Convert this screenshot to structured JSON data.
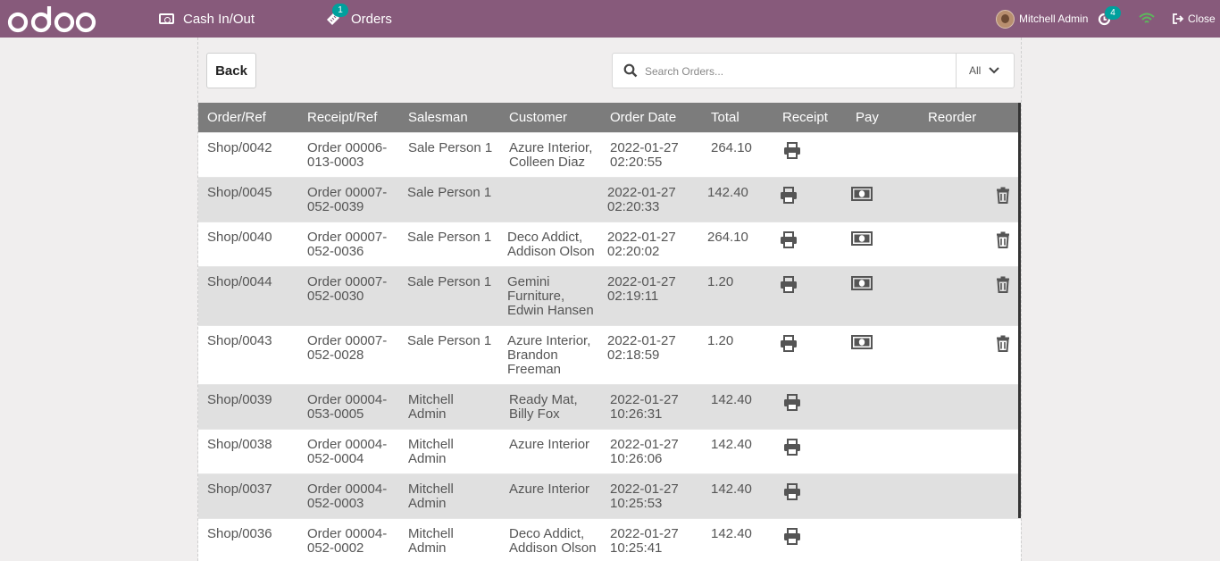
{
  "topbar": {
    "logo_text": "odoo",
    "cash_label": "Cash In/Out",
    "orders_label": "Orders",
    "orders_badge": "1",
    "user_name": "Mitchell Admin",
    "sync_badge": "4",
    "close_label": "Close",
    "colors": {
      "bar": "#875a7b",
      "badge": "#00a09d",
      "wifi": "#5cb85c"
    }
  },
  "toolbar": {
    "back_label": "Back",
    "search_placeholder": "Search Orders...",
    "filter_label": "All"
  },
  "table": {
    "columns": [
      "Order/Ref",
      "Receipt/Ref",
      "Salesman",
      "Customer",
      "Order Date",
      "Total",
      "Receipt",
      "Pay",
      "Reorder"
    ],
    "rows": [
      {
        "order": "Shop/0042",
        "receipt": [
          "Order 00006-",
          "013-0003"
        ],
        "salesman": [
          "Sale Person 1"
        ],
        "customer": [
          "Azure Interior,",
          "Colleen Diaz"
        ],
        "date": [
          "2022-01-27",
          "02:20:55"
        ],
        "total": "264.10",
        "pay": false,
        "reorder": false
      },
      {
        "order": "Shop/0045",
        "receipt": [
          "Order 00007-",
          "052-0039"
        ],
        "salesman": [
          "Sale Person 1"
        ],
        "customer": [],
        "date": [
          "2022-01-27",
          "02:20:33"
        ],
        "total": "142.40",
        "pay": true,
        "reorder": true
      },
      {
        "order": "Shop/0040",
        "receipt": [
          "Order 00007-",
          "052-0036"
        ],
        "salesman": [
          "Sale Person 1"
        ],
        "customer": [
          "Deco Addict,",
          "Addison Olson"
        ],
        "date": [
          "2022-01-27",
          "02:20:02"
        ],
        "total": "264.10",
        "pay": true,
        "reorder": true
      },
      {
        "order": "Shop/0044",
        "receipt": [
          "Order 00007-",
          "052-0030"
        ],
        "salesman": [
          "Sale Person 1"
        ],
        "customer": [
          "Gemini",
          "Furniture,",
          "Edwin Hansen"
        ],
        "date": [
          "2022-01-27",
          "02:19:11"
        ],
        "total": "1.20",
        "pay": true,
        "reorder": true
      },
      {
        "order": "Shop/0043",
        "receipt": [
          "Order 00007-",
          "052-0028"
        ],
        "salesman": [
          "Sale Person 1"
        ],
        "customer": [
          "Azure Interior,",
          "Brandon",
          "Freeman"
        ],
        "date": [
          "2022-01-27",
          "02:18:59"
        ],
        "total": "1.20",
        "pay": true,
        "reorder": true
      },
      {
        "order": "Shop/0039",
        "receipt": [
          "Order 00004-",
          "053-0005"
        ],
        "salesman": [
          "Mitchell",
          "Admin"
        ],
        "customer": [
          "Ready Mat,",
          "Billy Fox"
        ],
        "date": [
          "2022-01-27",
          "10:26:31"
        ],
        "total": "142.40",
        "pay": false,
        "reorder": false
      },
      {
        "order": "Shop/0038",
        "receipt": [
          "Order 00004-",
          "052-0004"
        ],
        "salesman": [
          "Mitchell",
          "Admin"
        ],
        "customer": [
          "Azure Interior"
        ],
        "date": [
          "2022-01-27",
          "10:26:06"
        ],
        "total": "142.40",
        "pay": false,
        "reorder": false
      },
      {
        "order": "Shop/0037",
        "receipt": [
          "Order 00004-",
          "052-0003"
        ],
        "salesman": [
          "Mitchell",
          "Admin"
        ],
        "customer": [
          "Azure Interior"
        ],
        "date": [
          "2022-01-27",
          "10:25:53"
        ],
        "total": "142.40",
        "pay": false,
        "reorder": false
      },
      {
        "order": "Shop/0036",
        "receipt": [
          "Order 00004-",
          "052-0002"
        ],
        "salesman": [
          "Mitchell",
          "Admin"
        ],
        "customer": [
          "Deco Addict,",
          "Addison Olson"
        ],
        "date": [
          "2022-01-27",
          "10:25:41"
        ],
        "total": "142.40",
        "pay": false,
        "reorder": false
      }
    ]
  }
}
